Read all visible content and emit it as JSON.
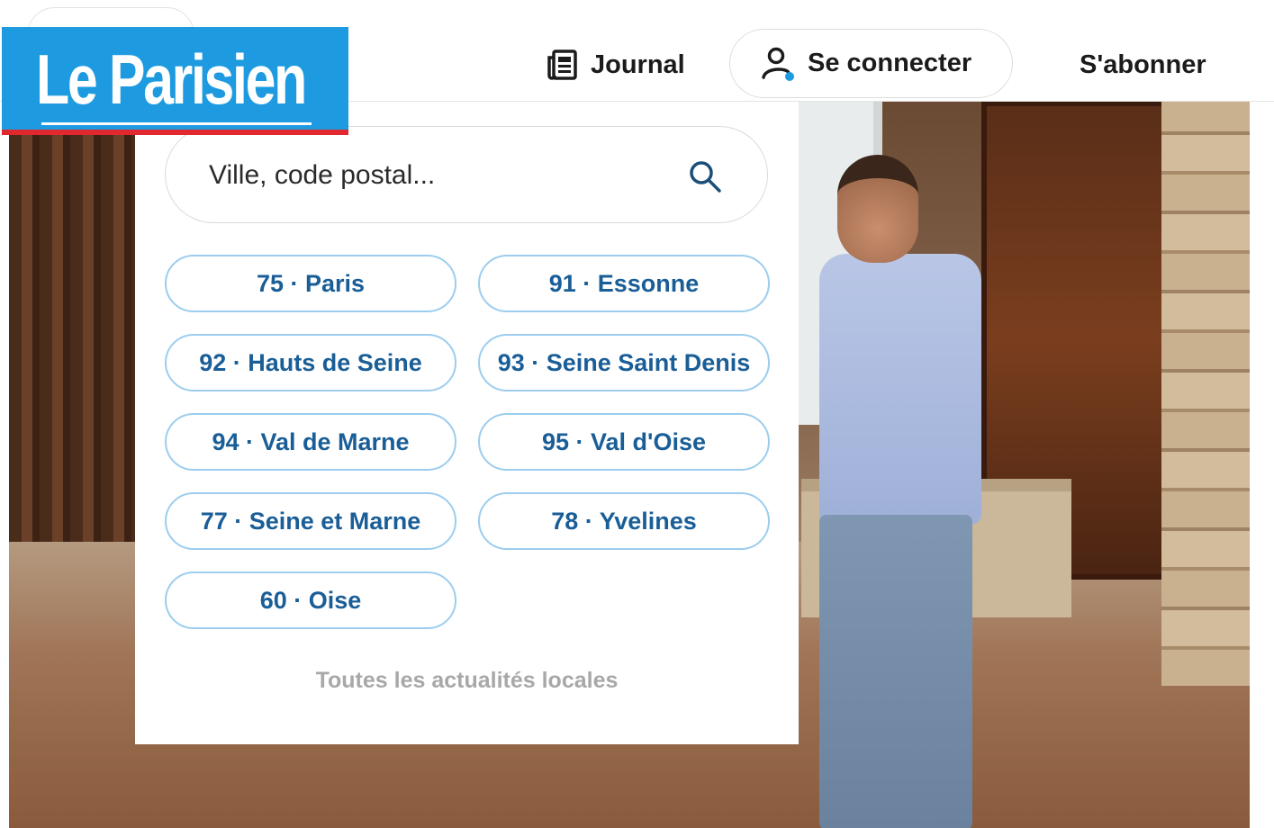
{
  "header": {
    "logo_text": "Le Parisien",
    "nav": {
      "journal_label": "Journal",
      "connect_label": "Se connecter",
      "subscribe_label": "S'abonner"
    }
  },
  "search": {
    "placeholder": "Ville, code postal..."
  },
  "regions": [
    {
      "label": "75 · Paris"
    },
    {
      "label": "91 · Essonne"
    },
    {
      "label": "92 · Hauts de Seine"
    },
    {
      "label": "93 · Seine Saint Denis"
    },
    {
      "label": "94 · Val de Marne"
    },
    {
      "label": "95 · Val d'Oise"
    },
    {
      "label": "77 · Seine et Marne"
    },
    {
      "label": "78 · Yvelines"
    },
    {
      "label": "60 · Oise"
    }
  ],
  "footer_link": "Toutes les actualités locales",
  "colors": {
    "brand_blue": "#1e9be0",
    "brand_red": "#e0282e",
    "chip_border": "#9ccdee",
    "chip_text": "#1a5e97",
    "link_grey": "#a8a8a8"
  },
  "icons": {
    "journal": "newspaper-icon",
    "connect": "user-icon",
    "search": "search-icon"
  }
}
